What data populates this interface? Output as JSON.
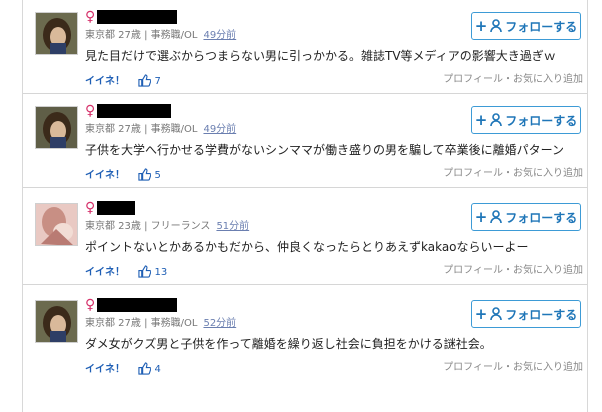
{
  "follow_label": "フォローする",
  "like_label": "イイネ！",
  "links_label": "プロフィール・お気に入り追加",
  "gender_symbol": "♀",
  "colors": {
    "accent": "#1f76b8",
    "button_border": "#3d9bd6",
    "female": "#d6336c"
  },
  "comments": [
    {
      "meta": "東京都 27歳 | 事務職/OL",
      "time": "49分前",
      "text": "見た目だけで選ぶからつまらない男に引っかかる。雑誌TV等メディアの影響大き過ぎｗ",
      "likes": "7"
    },
    {
      "meta": "東京都 27歳 | 事務職/OL",
      "time": "49分前",
      "text": "子供を大学へ行かせる学費がないシンママが働き盛りの男を騙して卒業後に離婚パターン",
      "likes": "5"
    },
    {
      "meta": "東京都 23歳 | フリーランス",
      "time": "51分前",
      "text": "ポイントないとかあるかもだから、仲良くなったらとりあえずkakaoならいーよー",
      "likes": "13"
    },
    {
      "meta": "東京都 27歳 | 事務職/OL",
      "time": "52分前",
      "text": "ダメ女がクズ男と子供を作って離婚を繰り返し社会に負担をかける謎社会。",
      "likes": "4"
    }
  ]
}
